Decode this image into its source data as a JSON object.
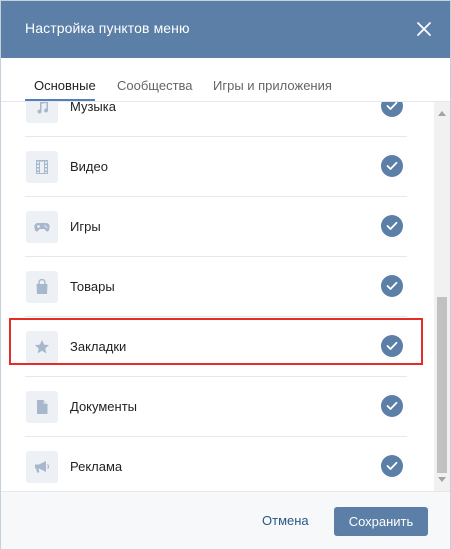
{
  "dialog": {
    "title": "Настройка пунктов меню",
    "close_icon": "close-icon"
  },
  "tabs": [
    {
      "label": "Основные",
      "active": true
    },
    {
      "label": "Сообщества",
      "active": false
    },
    {
      "label": "Игры и приложения",
      "active": false
    }
  ],
  "items": [
    {
      "label": "Музыка",
      "icon": "music-icon",
      "checked": true
    },
    {
      "label": "Видео",
      "icon": "video-icon",
      "checked": true
    },
    {
      "label": "Игры",
      "icon": "gamepad-icon",
      "checked": true
    },
    {
      "label": "Товары",
      "icon": "shopping-bag-icon",
      "checked": true
    },
    {
      "label": "Закладки",
      "icon": "star-icon",
      "checked": true,
      "highlighted": true
    },
    {
      "label": "Документы",
      "icon": "document-icon",
      "checked": true
    },
    {
      "label": "Реклама",
      "icon": "megaphone-icon",
      "checked": true
    }
  ],
  "footer": {
    "cancel_label": "Отмена",
    "save_label": "Сохранить"
  },
  "colors": {
    "header": "#5b7fa6",
    "accent": "#5181b8",
    "check": "#5b7fa6",
    "highlight": "#e52d27"
  }
}
